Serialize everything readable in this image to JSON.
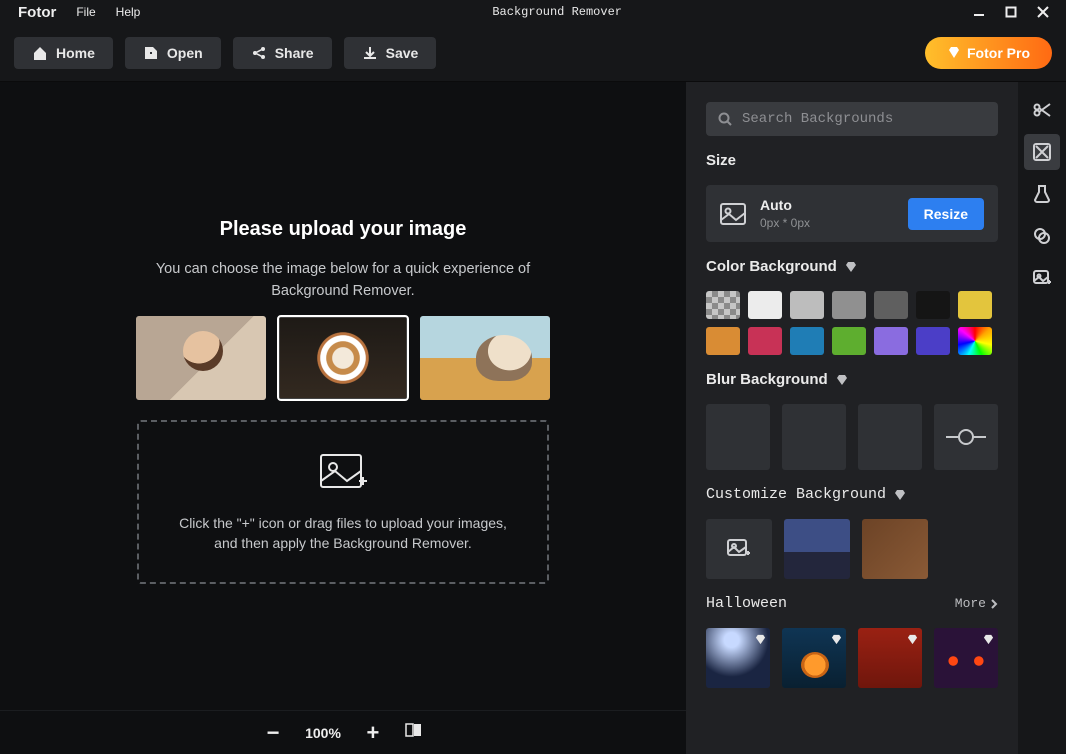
{
  "titlebar": {
    "brand": "Fotor",
    "menu": {
      "file": "File",
      "help": "Help"
    },
    "window_title": "Background Remover"
  },
  "toolbar": {
    "home": "Home",
    "open": "Open",
    "share": "Share",
    "save": "Save",
    "pro": "Fotor Pro"
  },
  "canvas": {
    "heading": "Please upload your image",
    "sub_line1": "You can choose the image below for a quick experience of",
    "sub_line2": "Background Remover.",
    "samples": [
      "portrait",
      "coffee",
      "dog"
    ],
    "drop_line1": "Click the \"+\" icon or drag files to upload your images,",
    "drop_line2": "and then apply the Background Remover.",
    "zoom": "100%"
  },
  "rightpanel": {
    "search_placeholder": "Search Backgrounds",
    "size": {
      "title": "Size",
      "mode": "Auto",
      "dims": "0px * 0px",
      "resize": "Resize"
    },
    "color_bg": {
      "title": "Color Background",
      "swatches": [
        "transparent",
        "#ececec",
        "#bdbdbd",
        "#909090",
        "#5f5f5f",
        "#151515",
        "#e3c53d",
        "#d98c34",
        "#c83256",
        "#1f7db5",
        "#5eae2f",
        "#8a6ce0",
        "#4b3ec7",
        "rainbow"
      ]
    },
    "blur_bg": {
      "title": "Blur Background"
    },
    "customize": {
      "title": "Customize Background"
    },
    "halloween": {
      "title": "Halloween",
      "more": "More"
    }
  },
  "sidetools": [
    "scissors",
    "remove-bg",
    "beaker",
    "color-layers",
    "image-plus"
  ]
}
